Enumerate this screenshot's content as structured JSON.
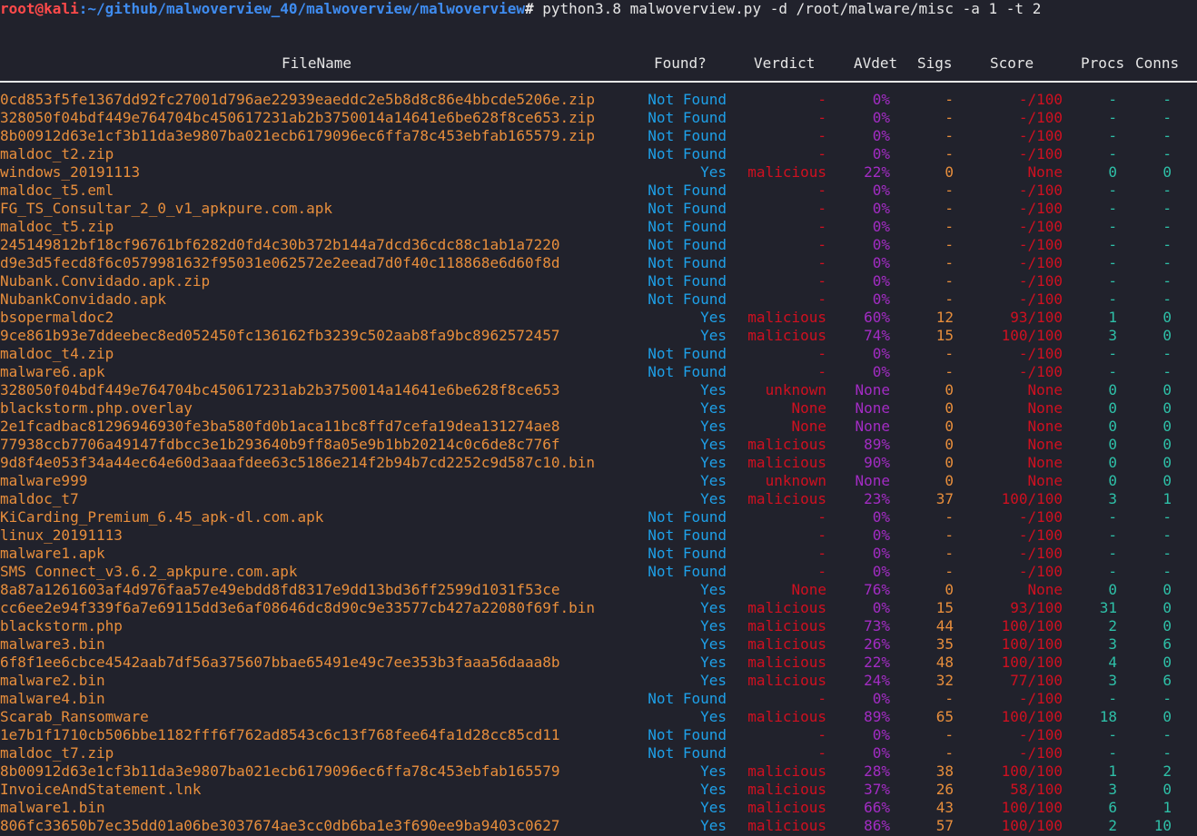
{
  "prompt": {
    "user": "root",
    "at": "@",
    "host": "kali",
    "path": ":~/github/malwoverview_40/malwoverview/malwoverview",
    "symbol": "# ",
    "command": "python3.8 malwoverview.py -d /root/malware/misc -a 1 -t 2"
  },
  "headers": {
    "filename": "FileName",
    "found": "Found?",
    "verdict": "Verdict",
    "avdet": "AVdet",
    "sigs": "Sigs",
    "score": "Score",
    "procs": "Procs",
    "conns": "Conns"
  },
  "rows": [
    {
      "file": "0cd853f5fe1367dd92fc27001d796ae22939eaeddc2e5b8d8c86e4bbcde5206e.zip",
      "found": "Not Found",
      "verdict": "-",
      "avdet": "0%",
      "sigs": "-",
      "score": "-/100",
      "procs": "-",
      "conns": "-"
    },
    {
      "file": "328050f04bdf449e764704bc450617231ab2b3750014a14641e6be628f8ce653.zip",
      "found": "Not Found",
      "verdict": "-",
      "avdet": "0%",
      "sigs": "-",
      "score": "-/100",
      "procs": "-",
      "conns": "-"
    },
    {
      "file": "8b00912d63e1cf3b11da3e9807ba021ecb6179096ec6ffa78c453ebfab165579.zip",
      "found": "Not Found",
      "verdict": "-",
      "avdet": "0%",
      "sigs": "-",
      "score": "-/100",
      "procs": "-",
      "conns": "-"
    },
    {
      "file": "maldoc_t2.zip",
      "found": "Not Found",
      "verdict": "-",
      "avdet": "0%",
      "sigs": "-",
      "score": "-/100",
      "procs": "-",
      "conns": "-"
    },
    {
      "file": "windows_20191113",
      "found": "Yes",
      "verdict": "malicious",
      "avdet": "22%",
      "sigs": "0",
      "score": "None",
      "procs": "0",
      "conns": "0"
    },
    {
      "file": "maldoc_t5.eml",
      "found": "Not Found",
      "verdict": "-",
      "avdet": "0%",
      "sigs": "-",
      "score": "-/100",
      "procs": "-",
      "conns": "-"
    },
    {
      "file": "FG_TS_Consultar_2_0_v1_apkpure.com.apk",
      "found": "Not Found",
      "verdict": "-",
      "avdet": "0%",
      "sigs": "-",
      "score": "-/100",
      "procs": "-",
      "conns": "-"
    },
    {
      "file": "maldoc_t5.zip",
      "found": "Not Found",
      "verdict": "-",
      "avdet": "0%",
      "sigs": "-",
      "score": "-/100",
      "procs": "-",
      "conns": "-"
    },
    {
      "file": "245149812bf18cf96761bf6282d0fd4c30b372b144a7dcd36cdc88c1ab1a7220",
      "found": "Not Found",
      "verdict": "-",
      "avdet": "0%",
      "sigs": "-",
      "score": "-/100",
      "procs": "-",
      "conns": "-"
    },
    {
      "file": "d9e3d5fecd8f6c0579981632f95031e062572e2eead7d0f40c118868e6d60f8d",
      "found": "Not Found",
      "verdict": "-",
      "avdet": "0%",
      "sigs": "-",
      "score": "-/100",
      "procs": "-",
      "conns": "-"
    },
    {
      "file": "Nubank.Convidado.apk.zip",
      "found": "Not Found",
      "verdict": "-",
      "avdet": "0%",
      "sigs": "-",
      "score": "-/100",
      "procs": "-",
      "conns": "-"
    },
    {
      "file": "NubankConvidado.apk",
      "found": "Not Found",
      "verdict": "-",
      "avdet": "0%",
      "sigs": "-",
      "score": "-/100",
      "procs": "-",
      "conns": "-"
    },
    {
      "file": "bsopermaldoc2",
      "found": "Yes",
      "verdict": "malicious",
      "avdet": "60%",
      "sigs": "12",
      "score": "93/100",
      "procs": "1",
      "conns": "0"
    },
    {
      "file": "9ce861b93e7ddeebec8ed052450fc136162fb3239c502aab8fa9bc8962572457",
      "found": "Yes",
      "verdict": "malicious",
      "avdet": "74%",
      "sigs": "15",
      "score": "100/100",
      "procs": "3",
      "conns": "0"
    },
    {
      "file": "maldoc_t4.zip",
      "found": "Not Found",
      "verdict": "-",
      "avdet": "0%",
      "sigs": "-",
      "score": "-/100",
      "procs": "-",
      "conns": "-"
    },
    {
      "file": "malware6.apk",
      "found": "Not Found",
      "verdict": "-",
      "avdet": "0%",
      "sigs": "-",
      "score": "-/100",
      "procs": "-",
      "conns": "-"
    },
    {
      "file": "328050f04bdf449e764704bc450617231ab2b3750014a14641e6be628f8ce653",
      "found": "Yes",
      "verdict": "unknown",
      "avdet": "None",
      "sigs": "0",
      "score": "None",
      "procs": "0",
      "conns": "0"
    },
    {
      "file": "blackstorm.php.overlay",
      "found": "Yes",
      "verdict": "None",
      "avdet": "None",
      "sigs": "0",
      "score": "None",
      "procs": "0",
      "conns": "0"
    },
    {
      "file": "2e1fcadbac81296946930fe3ba580fd0b1aca11bc8ffd7cefa19dea131274ae8",
      "found": "Yes",
      "verdict": "None",
      "avdet": "None",
      "sigs": "0",
      "score": "None",
      "procs": "0",
      "conns": "0"
    },
    {
      "file": "77938ccb7706a49147fdbcc3e1b293640b9ff8a05e9b1bb20214c0c6de8c776f",
      "found": "Yes",
      "verdict": "malicious",
      "avdet": "89%",
      "sigs": "0",
      "score": "None",
      "procs": "0",
      "conns": "0"
    },
    {
      "file": "9d8f4e053f34a44ec64e60d3aaafdee63c5186e214f2b94b7cd2252c9d587c10.bin",
      "found": "Yes",
      "verdict": "malicious",
      "avdet": "90%",
      "sigs": "0",
      "score": "None",
      "procs": "0",
      "conns": "0"
    },
    {
      "file": "malware999",
      "found": "Yes",
      "verdict": "unknown",
      "avdet": "None",
      "sigs": "0",
      "score": "None",
      "procs": "0",
      "conns": "0"
    },
    {
      "file": "maldoc_t7",
      "found": "Yes",
      "verdict": "malicious",
      "avdet": "23%",
      "sigs": "37",
      "score": "100/100",
      "procs": "3",
      "conns": "1"
    },
    {
      "file": "KiCarding_Premium_6.45_apk-dl.com.apk",
      "found": "Not Found",
      "verdict": "-",
      "avdet": "0%",
      "sigs": "-",
      "score": "-/100",
      "procs": "-",
      "conns": "-"
    },
    {
      "file": "linux_20191113",
      "found": "Not Found",
      "verdict": "-",
      "avdet": "0%",
      "sigs": "-",
      "score": "-/100",
      "procs": "-",
      "conns": "-"
    },
    {
      "file": "malware1.apk",
      "found": "Not Found",
      "verdict": "-",
      "avdet": "0%",
      "sigs": "-",
      "score": "-/100",
      "procs": "-",
      "conns": "-"
    },
    {
      "file": "SMS Connect_v3.6.2_apkpure.com.apk",
      "found": "Not Found",
      "verdict": "-",
      "avdet": "0%",
      "sigs": "-",
      "score": "-/100",
      "procs": "-",
      "conns": "-"
    },
    {
      "file": "8a87a1261603af4d976faa57e49ebdd8fd8317e9dd13bd36ff2599d1031f53ce",
      "found": "Yes",
      "verdict": "None",
      "avdet": "76%",
      "sigs": "0",
      "score": "None",
      "procs": "0",
      "conns": "0"
    },
    {
      "file": "cc6ee2e94f339f6a7e69115dd3e6af08646dc8d90c9e33577cb427a22080f69f.bin",
      "found": "Yes",
      "verdict": "malicious",
      "avdet": "0%",
      "sigs": "15",
      "score": "93/100",
      "procs": "31",
      "conns": "0"
    },
    {
      "file": "blackstorm.php",
      "found": "Yes",
      "verdict": "malicious",
      "avdet": "73%",
      "sigs": "44",
      "score": "100/100",
      "procs": "2",
      "conns": "0"
    },
    {
      "file": "malware3.bin",
      "found": "Yes",
      "verdict": "malicious",
      "avdet": "26%",
      "sigs": "35",
      "score": "100/100",
      "procs": "3",
      "conns": "6"
    },
    {
      "file": "6f8f1ee6cbce4542aab7df56a375607bbae65491e49c7ee353b3faaa56daaa8b",
      "found": "Yes",
      "verdict": "malicious",
      "avdet": "22%",
      "sigs": "48",
      "score": "100/100",
      "procs": "4",
      "conns": "0"
    },
    {
      "file": "malware2.bin",
      "found": "Yes",
      "verdict": "malicious",
      "avdet": "24%",
      "sigs": "32",
      "score": "77/100",
      "procs": "3",
      "conns": "6"
    },
    {
      "file": "malware4.bin",
      "found": "Not Found",
      "verdict": "-",
      "avdet": "0%",
      "sigs": "-",
      "score": "-/100",
      "procs": "-",
      "conns": "-"
    },
    {
      "file": "Scarab_Ransomware",
      "found": "Yes",
      "verdict": "malicious",
      "avdet": "89%",
      "sigs": "65",
      "score": "100/100",
      "procs": "18",
      "conns": "0"
    },
    {
      "file": "1e7b1f1710cb506bbe1182fff6f762ad8543c6c13f768fee64fa1d28cc85cd11",
      "found": "Not Found",
      "verdict": "-",
      "avdet": "0%",
      "sigs": "-",
      "score": "-/100",
      "procs": "-",
      "conns": "-"
    },
    {
      "file": "maldoc_t7.zip",
      "found": "Not Found",
      "verdict": "-",
      "avdet": "0%",
      "sigs": "-",
      "score": "-/100",
      "procs": "-",
      "conns": "-"
    },
    {
      "file": "8b00912d63e1cf3b11da3e9807ba021ecb6179096ec6ffa78c453ebfab165579",
      "found": "Yes",
      "verdict": "malicious",
      "avdet": "28%",
      "sigs": "38",
      "score": "100/100",
      "procs": "1",
      "conns": "2"
    },
    {
      "file": "InvoiceAndStatement.lnk",
      "found": "Yes",
      "verdict": "malicious",
      "avdet": "37%",
      "sigs": "26",
      "score": "58/100",
      "procs": "3",
      "conns": "0"
    },
    {
      "file": "malware1.bin",
      "found": "Yes",
      "verdict": "malicious",
      "avdet": "66%",
      "sigs": "43",
      "score": "100/100",
      "procs": "6",
      "conns": "1"
    },
    {
      "file": "806fc33650b7ec35dd01a06be3037674ae3cc0db6ba1e3f690ee9ba9403c0627",
      "found": "Yes",
      "verdict": "malicious",
      "avdet": "86%",
      "sigs": "57",
      "score": "100/100",
      "procs": "2",
      "conns": "10"
    }
  ]
}
